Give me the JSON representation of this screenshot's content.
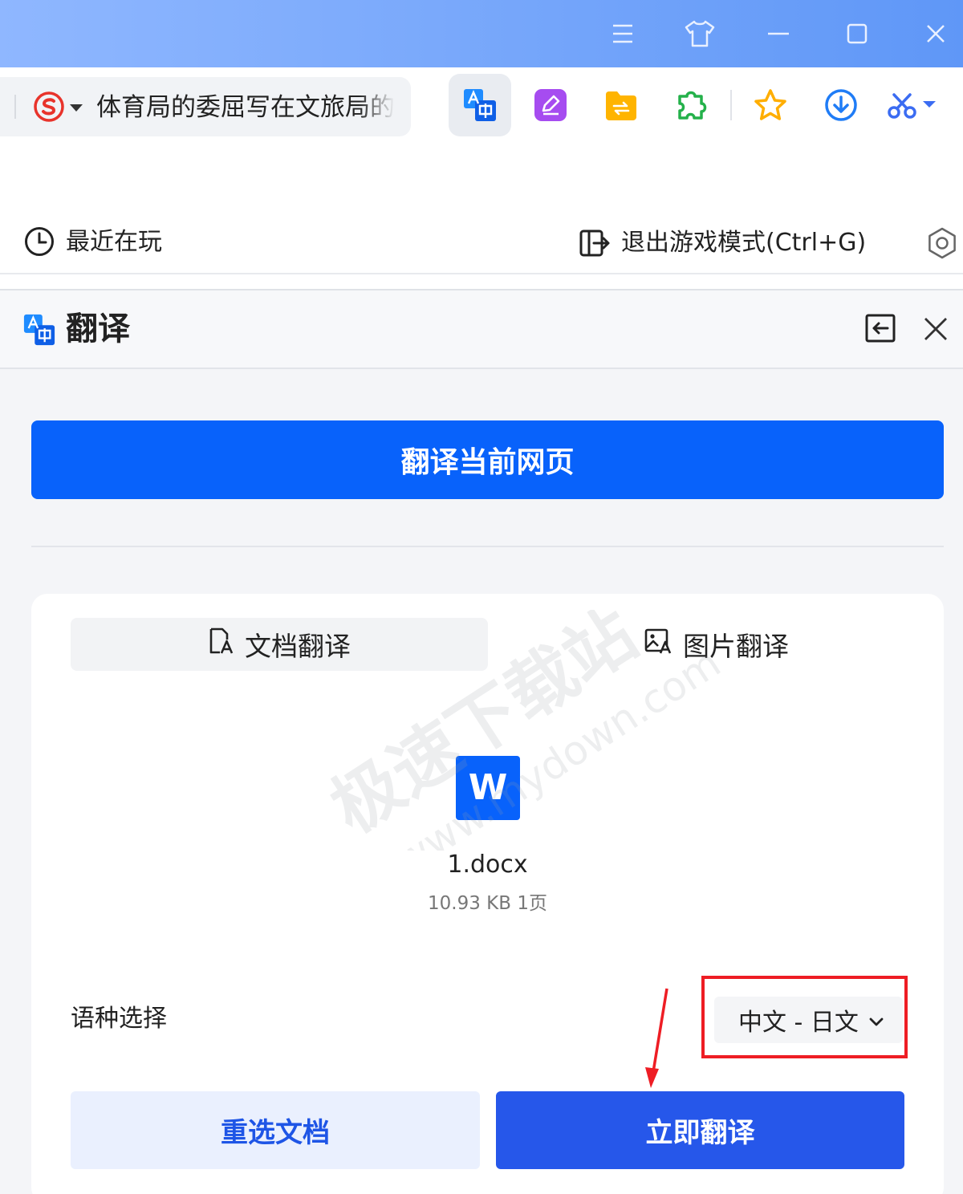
{
  "toolbar": {
    "address_text": "体育局的委屈写在文旅局的"
  },
  "game_bar": {
    "recent_label": "最近在玩",
    "exit_label": "退出游戏模式(Ctrl+G)"
  },
  "panel": {
    "title": "翻译",
    "translate_page_button": "翻译当前网页",
    "tabs": [
      {
        "label": "文档翻译",
        "active": true
      },
      {
        "label": "图片翻译",
        "active": false
      }
    ],
    "file": {
      "icon_letter": "W",
      "name": "1.docx",
      "meta": "10.93 KB 1页"
    },
    "language": {
      "label": "语种选择",
      "value": "中文 - 日文"
    },
    "reselect_button": "重选文档",
    "translate_now_button": "立即翻译"
  },
  "watermark": {
    "line1": "极速下载站",
    "line2": "www.mydown.com"
  },
  "colors": {
    "accent": "#0862fb",
    "button_blue": "#2657ea",
    "secondary_bg": "#eaf0fe",
    "highlight": "#ee1d24"
  }
}
